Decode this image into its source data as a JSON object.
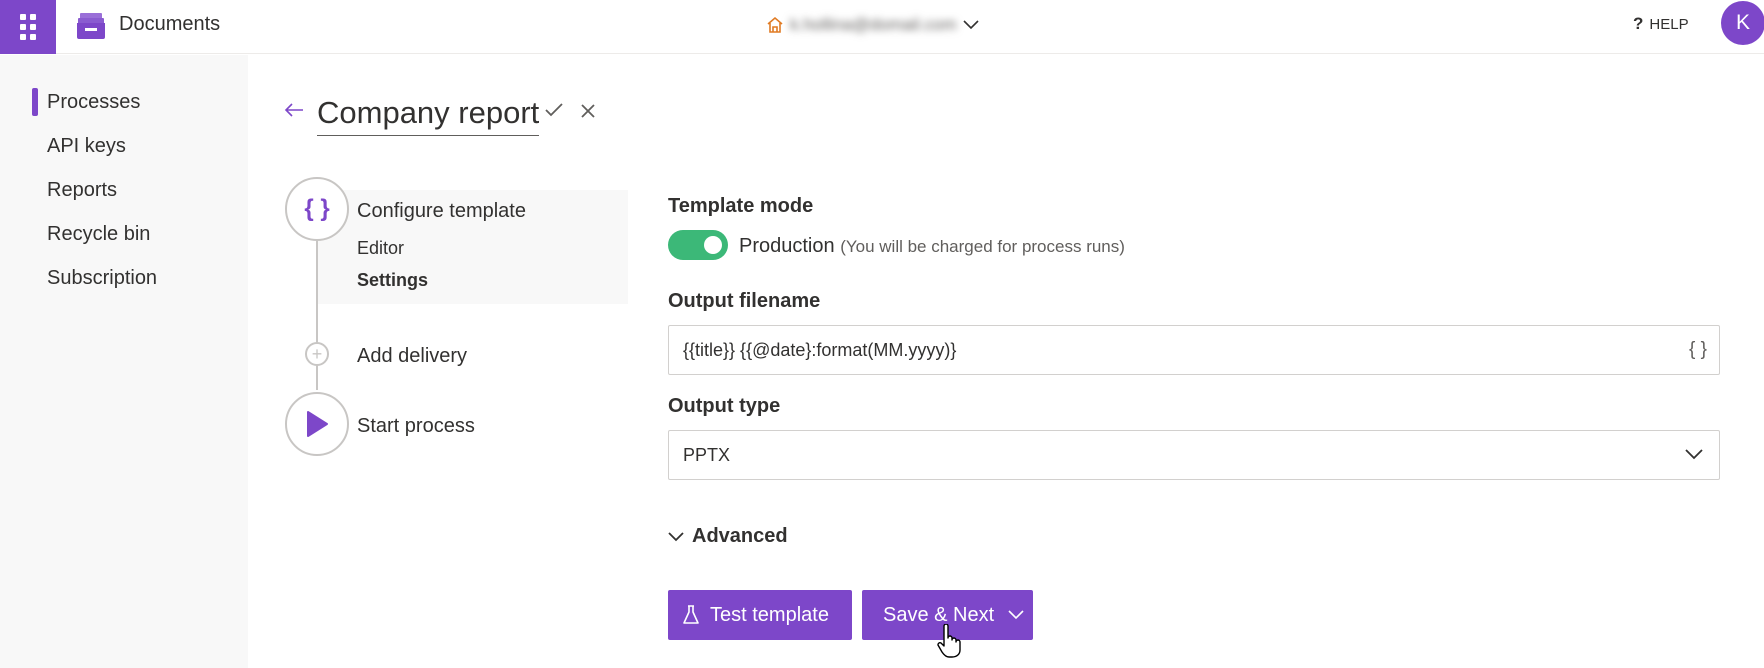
{
  "header": {
    "app_name": "Documents",
    "account_email": "k.hollina@domail.com",
    "help_label": "HELP",
    "avatar_initial": "K"
  },
  "sidebar": {
    "items": [
      {
        "label": "Processes",
        "active": true
      },
      {
        "label": "API keys"
      },
      {
        "label": "Reports"
      },
      {
        "label": "Recycle bin"
      },
      {
        "label": "Subscription"
      }
    ]
  },
  "page": {
    "title": "Company report"
  },
  "steps": {
    "configure": "Configure template",
    "editor": "Editor",
    "settings": "Settings",
    "delivery": "Add delivery",
    "start": "Start process"
  },
  "form": {
    "template_mode_label": "Template mode",
    "toggle_on": true,
    "production_label": "Production",
    "production_note": "(You will be charged for process runs)",
    "output_filename_label": "Output filename",
    "output_filename_value": "{{title}} {{@date}:format(MM.yyyy)}",
    "variables_icon": "{ }",
    "output_type_label": "Output type",
    "output_type_value": "PPTX",
    "advanced_label": "Advanced"
  },
  "actions": {
    "test_label": "Test template",
    "save_label": "Save & Next"
  },
  "colors": {
    "accent": "#7d47c9",
    "toggle_on": "#3cb878"
  }
}
